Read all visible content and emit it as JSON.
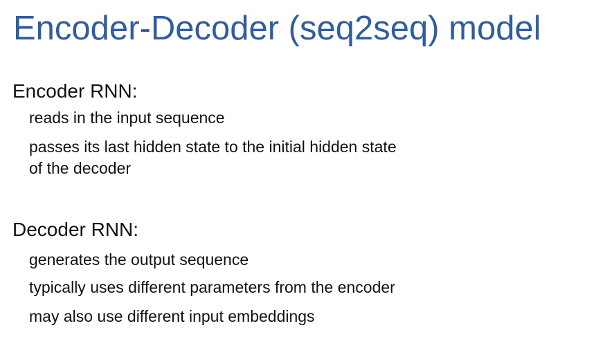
{
  "slide": {
    "title": "Encoder-Decoder (seq2seq) model",
    "title_color": "#2f5d9e",
    "sections": [
      {
        "heading": "Encoder RNN:",
        "bullets": [
          "reads in the input sequence",
          "passes its last hidden state to the initial hidden state",
          "of the decoder"
        ]
      },
      {
        "heading": "Decoder RNN:",
        "bullets": [
          "generates the output sequence",
          "typically uses different parameters from the encoder",
          "may also use different input embeddings"
        ]
      }
    ]
  }
}
